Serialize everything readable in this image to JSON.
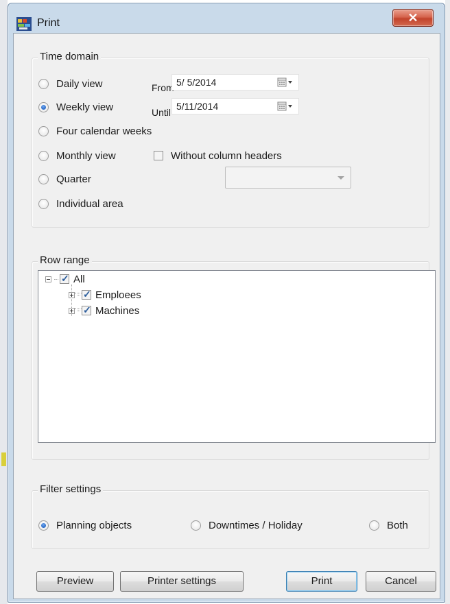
{
  "window": {
    "title": "Print",
    "close_glyph": "✕",
    "icon": "app-icon"
  },
  "time_domain": {
    "title": "Time domain",
    "options": [
      {
        "label": "Daily view",
        "checked": false
      },
      {
        "label": "Weekly view",
        "checked": true
      },
      {
        "label": "Four calendar weeks",
        "checked": false
      },
      {
        "label": "Monthly view",
        "checked": false
      },
      {
        "label": "Quarter",
        "checked": false
      },
      {
        "label": "Individual area",
        "checked": false
      }
    ],
    "from_label": "From",
    "from_value": "5/ 5/2014",
    "until_label": "Until",
    "until_value": "5/11/2014",
    "without_headers_label": "Without column headers",
    "without_headers_checked": false,
    "quarter_value": ""
  },
  "row_range": {
    "title": "Row range",
    "root": {
      "label": "All",
      "checked": true
    },
    "children": [
      {
        "label": "Emploees",
        "checked": true
      },
      {
        "label": "Machines",
        "checked": true
      }
    ]
  },
  "filter_settings": {
    "title": "Filter settings",
    "options": [
      {
        "label": "Planning objects",
        "checked": true
      },
      {
        "label": "Downtimes / Holiday",
        "checked": false
      },
      {
        "label": "Both",
        "checked": false
      }
    ]
  },
  "buttons": {
    "preview": "Preview",
    "printer_settings": "Printer settings",
    "print": "Print",
    "cancel": "Cancel"
  },
  "colors": {
    "close_button": "#c9432c",
    "radio_selected": "#1f5fbf",
    "default_button_border": "#3c7fb1"
  }
}
